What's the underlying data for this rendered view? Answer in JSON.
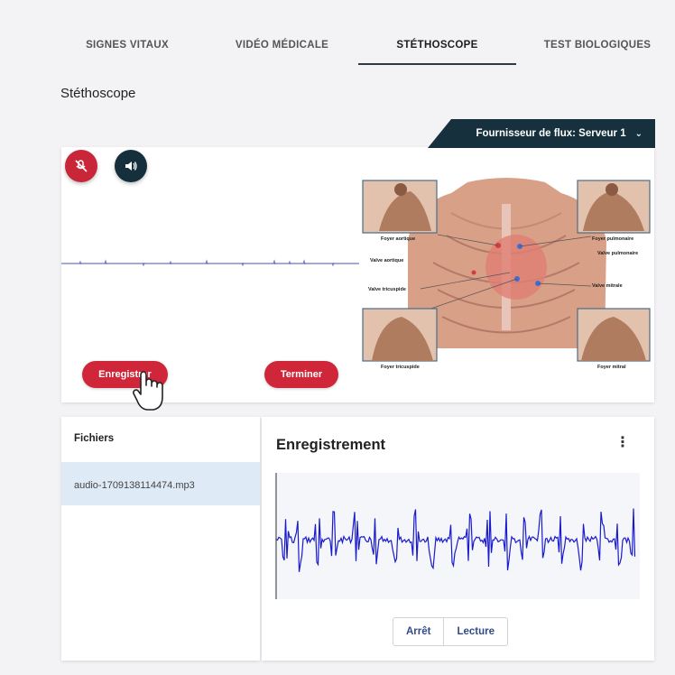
{
  "tabs": [
    {
      "label": "SIGNES VITAUX",
      "active": false
    },
    {
      "label": "VIDÉO MÉDICALE",
      "active": false
    },
    {
      "label": "STÉTHOSCOPE",
      "active": true
    },
    {
      "label": "TEST BIOLOGIQUES",
      "active": false
    }
  ],
  "section_title": "Stéthoscope",
  "provider": {
    "label": "Fournisseur de flux: Serveur 1"
  },
  "recorder": {
    "record_label": "Enregistrer",
    "stop_label": "Terminer"
  },
  "diagram_labels": {
    "foyer_aortique": "Foyer aortique",
    "foyer_pulmonaire": "Foyer pulmonaire",
    "valve_aortique": "Valve aortique",
    "valve_pulmonaire": "Valve pulmonaire",
    "valve_tricuspide": "Valve tricuspide",
    "valve_mitrale": "Valve mitrale",
    "foyer_tricuspide": "Foyer tricuspide",
    "foyer_mitral": "Foyer mitral"
  },
  "files": {
    "title": "Fichiers",
    "items": [
      "audio-1709138114474.mp3"
    ]
  },
  "recording": {
    "title": "Enregistrement",
    "stop_label": "Arrêt",
    "play_label": "Lecture"
  },
  "colors": {
    "accent_red": "#d0263a",
    "dark": "#15303c",
    "waveform": "#1a1acc"
  }
}
